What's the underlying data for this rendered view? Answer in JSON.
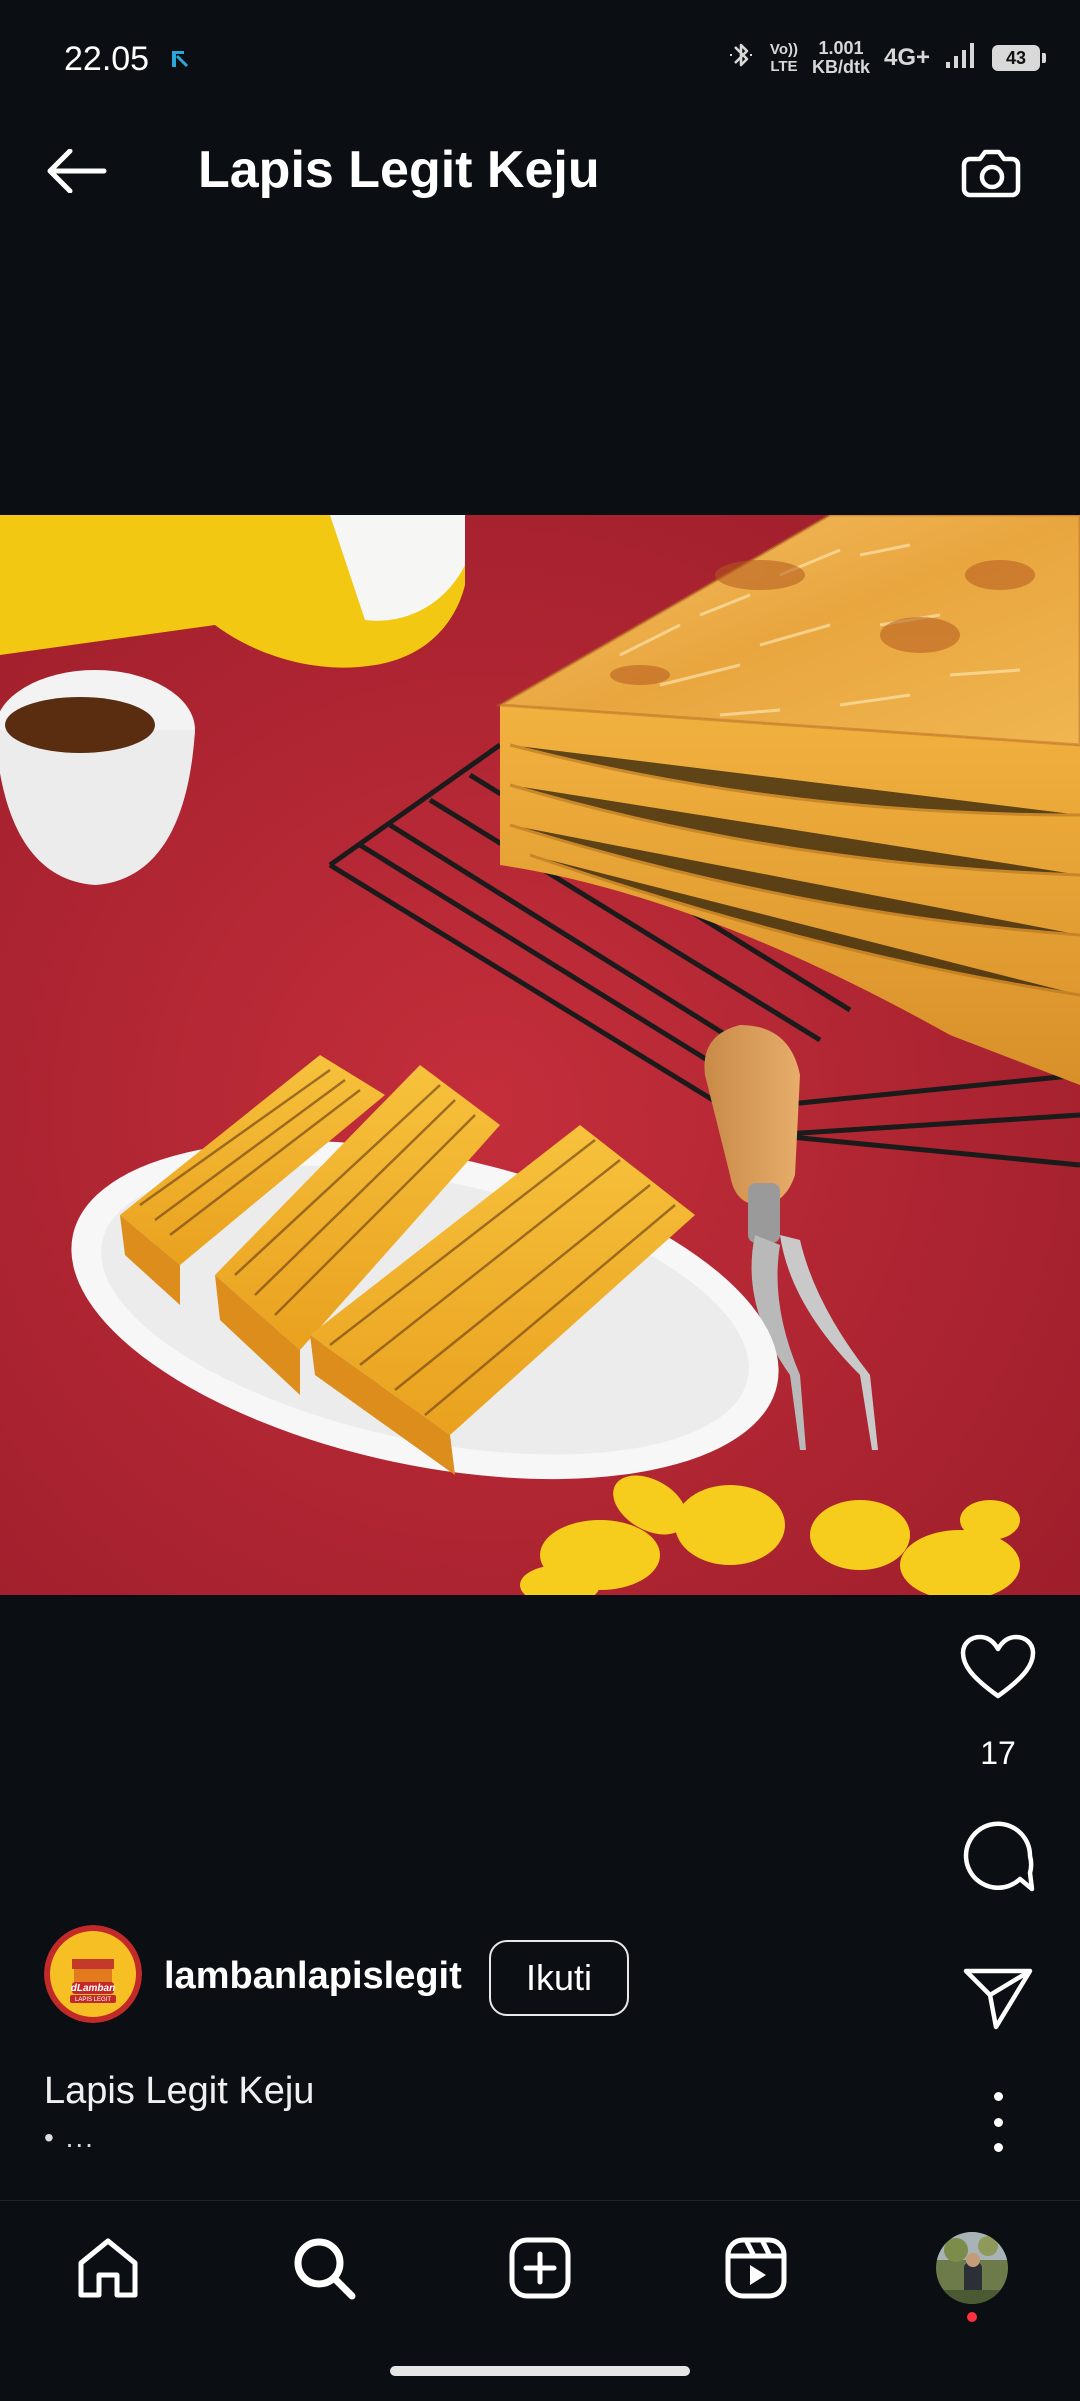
{
  "status_bar": {
    "time": "22.05",
    "volte_line1": "Vo))",
    "volte_line2": "LTE",
    "speed_line1": "1.001",
    "speed_line2": "KB/dtk",
    "network": "4G+",
    "battery": "43"
  },
  "header": {
    "title": "Lapis Legit Keju"
  },
  "post": {
    "like_count": "17",
    "author": "lambanlapislegit",
    "follow_label": "Ikuti",
    "caption": "Lapis Legit Keju",
    "caption_more": "• ..."
  },
  "brand_logo_text": "dLamban LAPIS LEGIT",
  "colors": {
    "background": "#0b0e12",
    "text": "#ffffff",
    "notification_dot": "#ff3040"
  },
  "icons": [
    "back-arrow-icon",
    "camera-icon",
    "heart-icon",
    "comment-icon",
    "send-icon",
    "more-icon",
    "home-icon",
    "search-icon",
    "create-icon",
    "reels-icon"
  ]
}
